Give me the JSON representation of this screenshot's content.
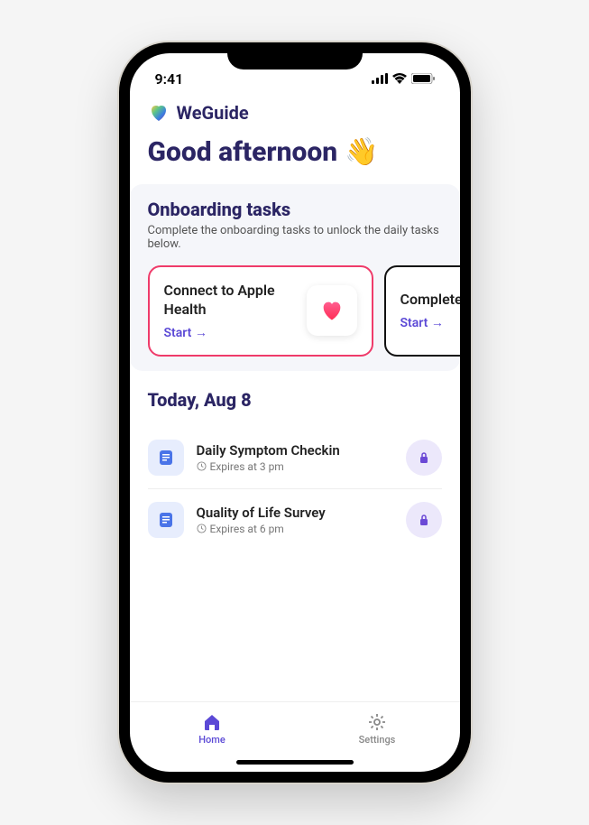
{
  "status": {
    "time": "9:41"
  },
  "app": {
    "name": "WeGuide"
  },
  "greeting": "Good afternoon",
  "onboarding": {
    "title": "Onboarding tasks",
    "subtitle": "Complete the onboarding tasks to unlock the daily tasks below.",
    "cards": [
      {
        "title": "Connect to Apple Health",
        "action": "Start →"
      },
      {
        "title": "Complete eConsent",
        "action": "Start →"
      }
    ]
  },
  "today": {
    "title": "Today, Aug 8",
    "tasks": [
      {
        "title": "Daily Symptom Checkin",
        "expires": "Expires at 3 pm"
      },
      {
        "title": "Quality of Life Survey",
        "expires": "Expires at 6 pm"
      }
    ]
  },
  "tabs": {
    "home": "Home",
    "settings": "Settings"
  }
}
